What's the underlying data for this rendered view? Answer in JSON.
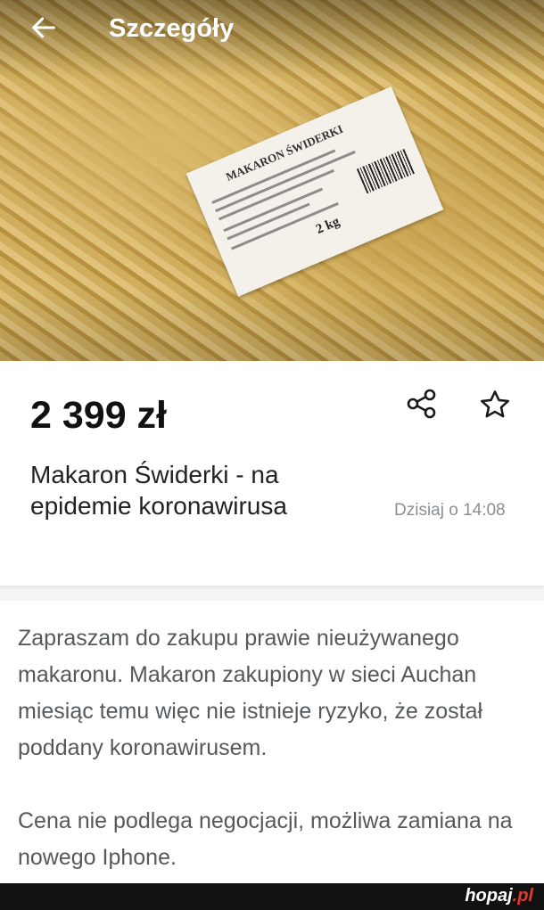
{
  "header": {
    "title": "Szczegóły"
  },
  "listing": {
    "price": "2 399 zł",
    "title": "Makaron Świderki - na epidemie koronawirusa",
    "date": "Dzisiaj o 14:08"
  },
  "photo": {
    "label_text": "MAKARON ŚWIDERKI",
    "weight": "2 kg"
  },
  "description": {
    "paragraph1": "Zapraszam do zakupu prawie nieużywanego makaronu. Makaron zakupiony w sieci Auchan miesiąc temu więc nie istnieje ryzyko, że został poddany koronawirusem.",
    "paragraph2": "Cena nie podlega negocjacji, możliwa zamiana na nowego Iphone."
  },
  "watermark": {
    "brand": "hopaj",
    "tld": ".pl"
  },
  "colors": {
    "accent": "#e03a2f",
    "text_primary": "#111111",
    "text_muted": "#8a8f93"
  },
  "icons": {
    "back": "arrow-left-icon",
    "share": "share-icon",
    "favorite": "star-outline-icon"
  }
}
